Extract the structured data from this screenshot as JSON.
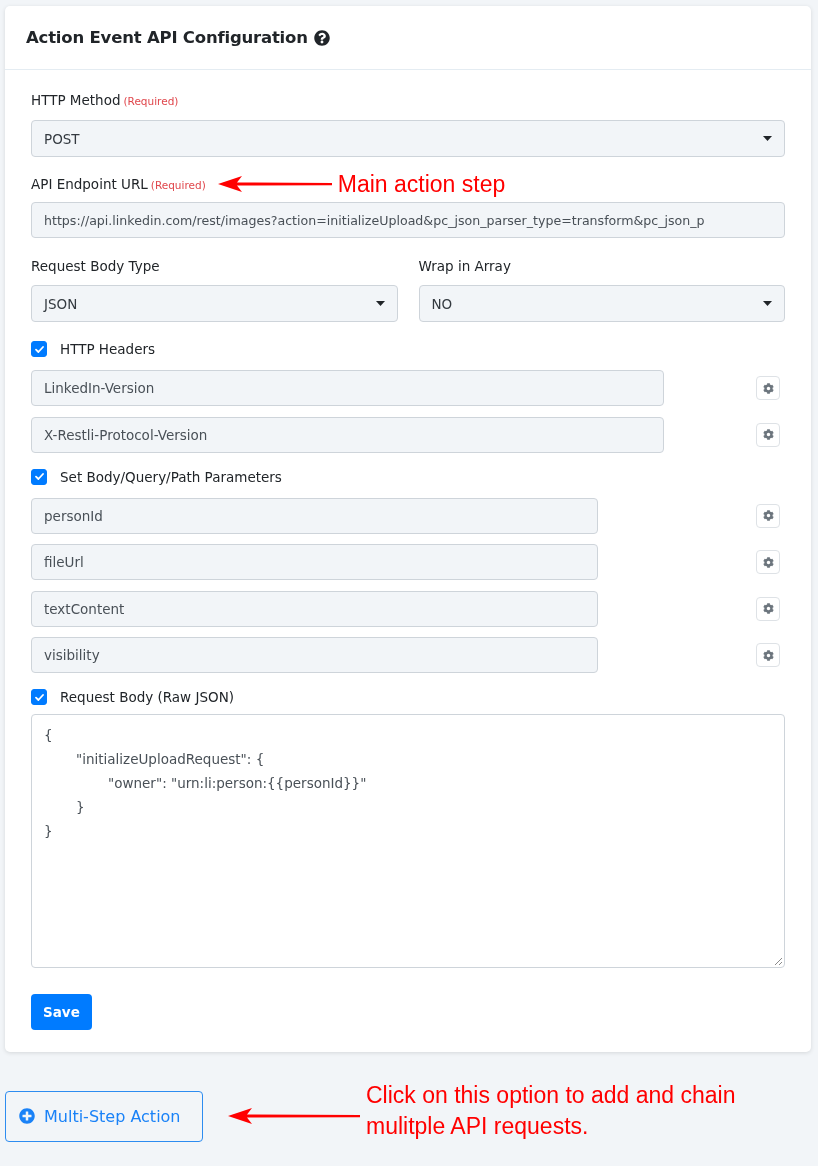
{
  "card": {
    "title": "Action Event API Configuration"
  },
  "http_method": {
    "label": "HTTP Method",
    "required": "(Required)",
    "value": "POST"
  },
  "endpoint": {
    "label": "API Endpoint URL",
    "required": "(Required)",
    "value": "https://api.linkedin.com/rest/images?action=initializeUpload&pc_json_parser_type=transform&pc_json_p",
    "annotation": "Main action step"
  },
  "body_options": [
    {
      "label": "Request Body Type",
      "value": "JSON"
    },
    {
      "label": "Wrap in Array",
      "value": "NO"
    }
  ],
  "sections": [
    {
      "kind": "headers",
      "label": "HTTP Headers",
      "checked": true,
      "fields": [
        "LinkedIn-Version",
        "X-Restli-Protocol-Version"
      ]
    },
    {
      "kind": "parameters",
      "label": "Set Body/Query/Path Parameters",
      "checked": true,
      "fields": [
        "personId",
        "fileUrl",
        "textContent",
        "visibility"
      ]
    }
  ],
  "raw_body": {
    "label": "Request Body (Raw JSON)",
    "checked": true,
    "value": "{\n\t\"initializeUploadRequest\": {\n\t\t\"owner\": \"urn:li:person:{{personId}}\"\n\t}\n}"
  },
  "save_button": "Save",
  "multi_step": {
    "label": "Multi-Step Action",
    "annotation_lines": [
      "Click on this option to add and chain",
      "mulitple API requests."
    ]
  }
}
